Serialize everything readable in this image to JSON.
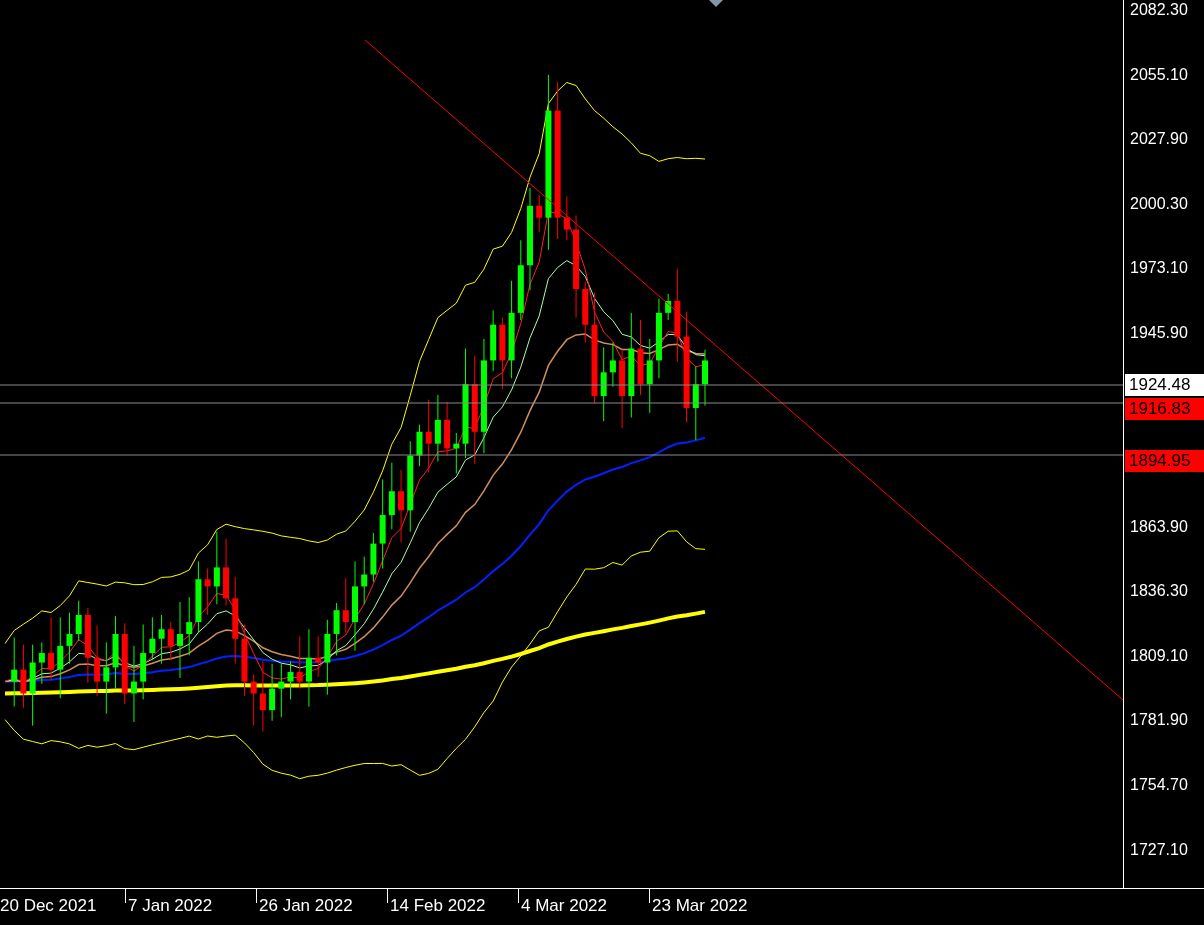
{
  "price_axis": {
    "labels": [
      "2082.30",
      "2055.10",
      "2027.90",
      "2000.30",
      "1973.10",
      "1945.90",
      "1863.90",
      "1836.30",
      "1809.10",
      "1781.90",
      "1754.70",
      "1727.10"
    ]
  },
  "price_tags": [
    {
      "text": "1924.48",
      "color": "#ffffff"
    },
    {
      "text": "1916.83",
      "color": "#ff0000"
    },
    {
      "text": "1894.95",
      "color": "#ff0000"
    }
  ],
  "time_axis": {
    "labels": [
      "20 Dec 2021",
      "7 Jan 2022",
      "26 Jan 2022",
      "14 Feb 2022",
      "4 Mar 2022",
      "23 Mar 2022"
    ]
  }
}
